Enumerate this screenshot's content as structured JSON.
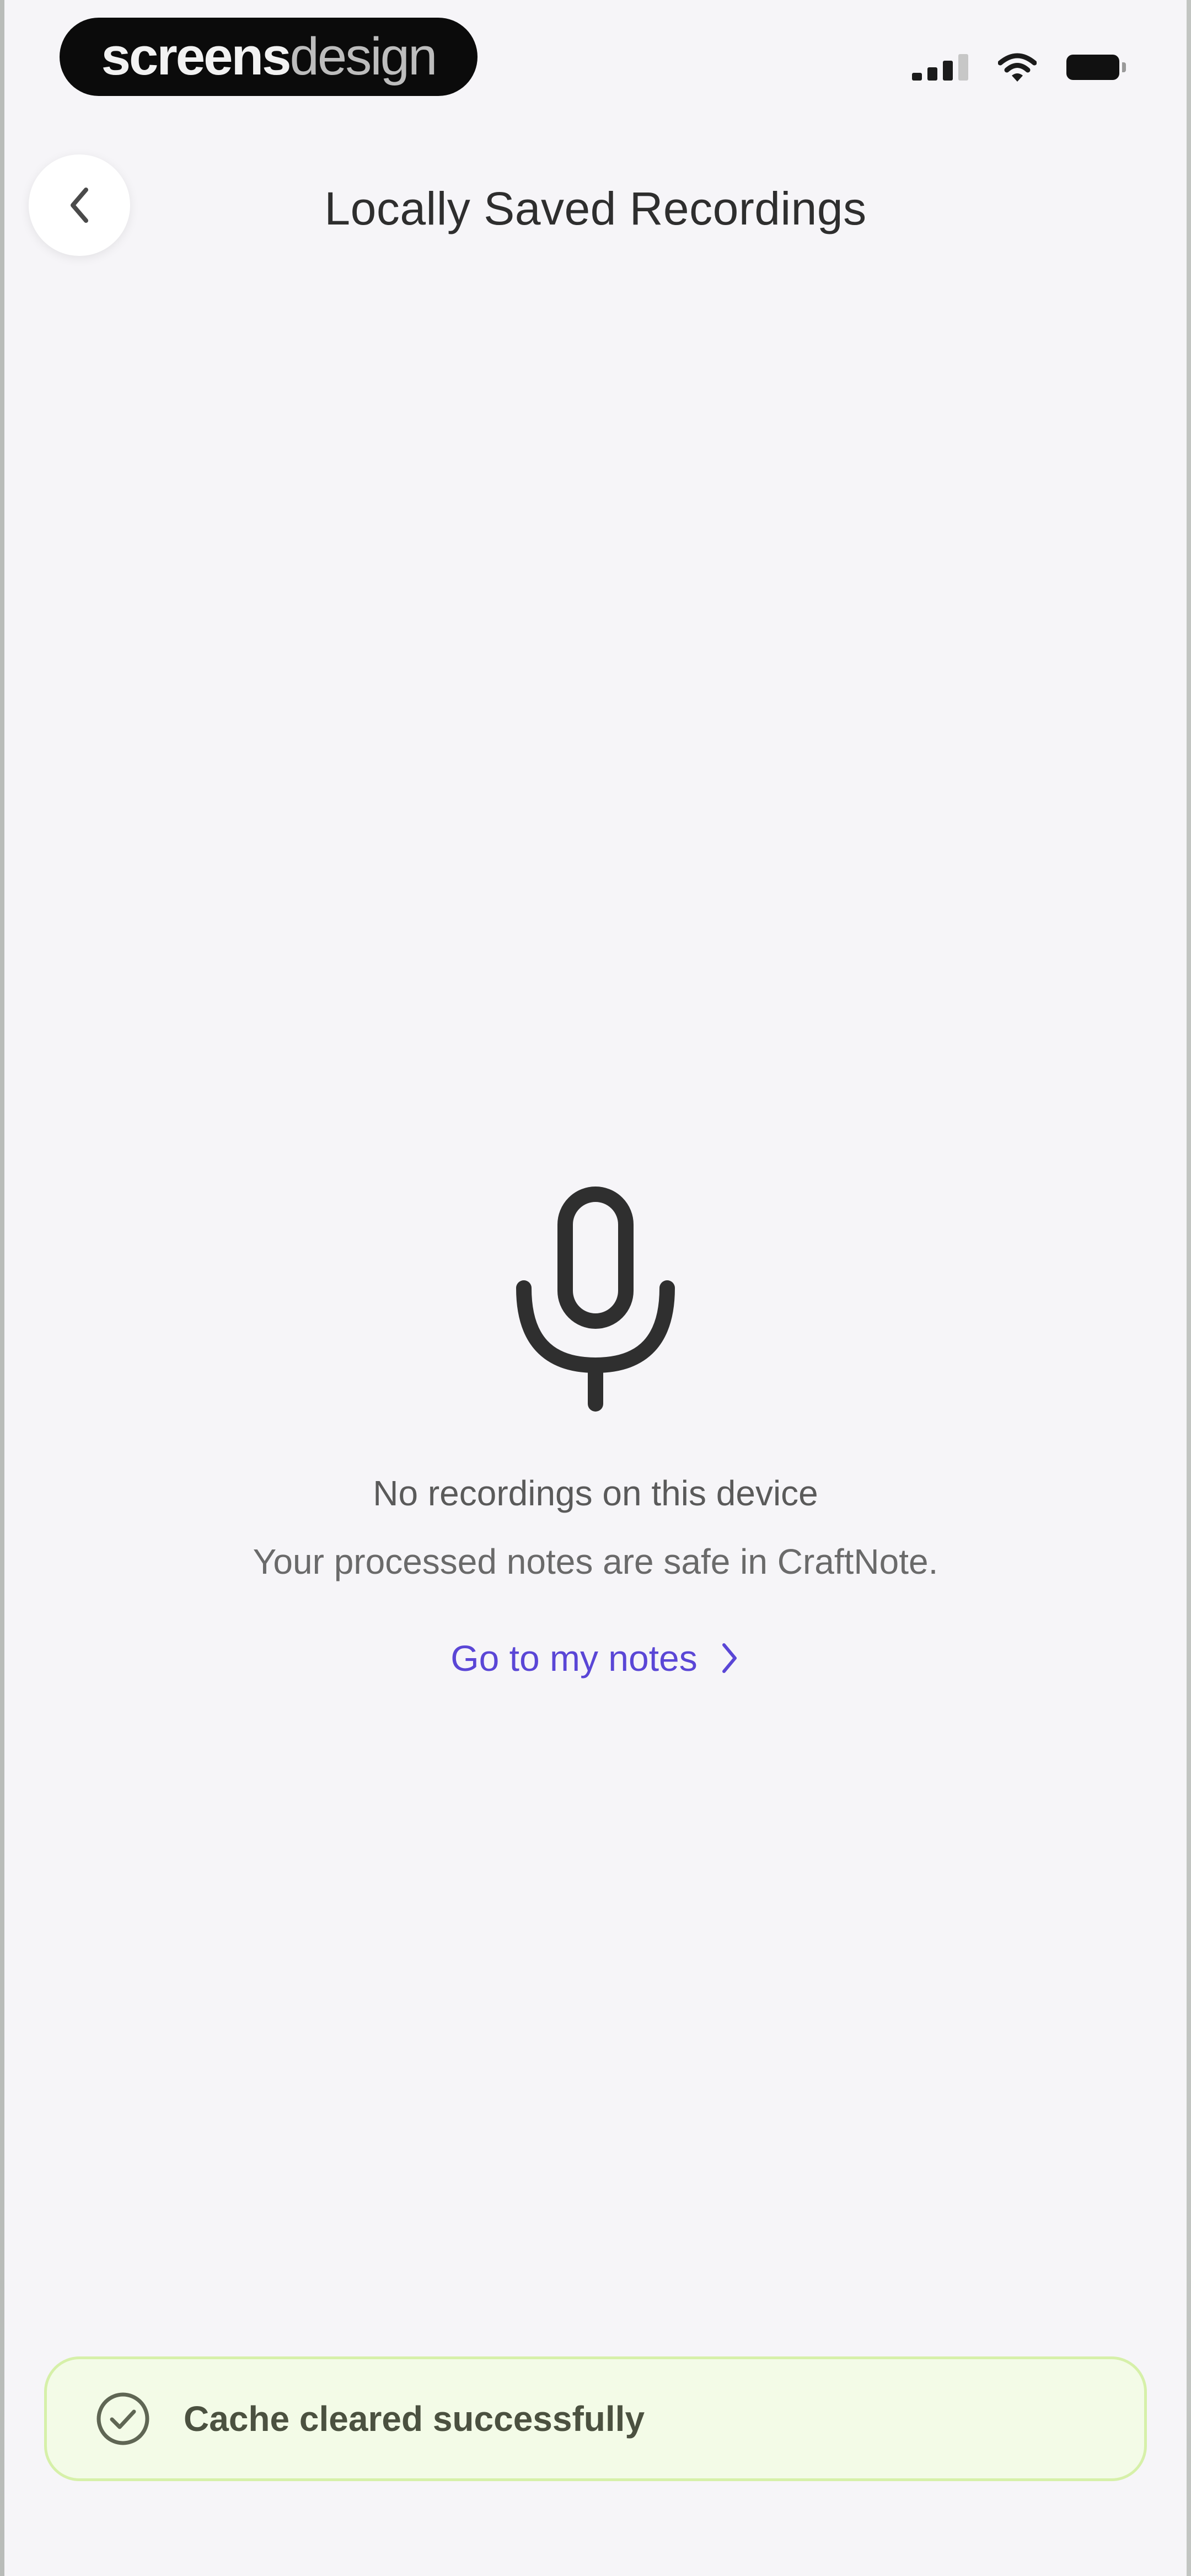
{
  "status_bar": {
    "brand_strong": "screens",
    "brand_light": "design",
    "icons": [
      "cellular-signal-icon",
      "wifi-icon",
      "battery-icon"
    ]
  },
  "header": {
    "back_icon": "chevron-left-icon",
    "title": "Locally Saved Recordings"
  },
  "empty_state": {
    "icon": "microphone-icon",
    "title": "No recordings on this device",
    "subtitle": "Your processed notes are safe in CraftNote.",
    "link_label": "Go to my notes",
    "link_icon": "chevron-right-icon"
  },
  "toast": {
    "icon": "check-circle-icon",
    "message": "Cache cleared successfully"
  },
  "colors": {
    "background": "#f6f5f8",
    "accent": "#5a46d6",
    "toast_background": "#f3fbe7",
    "toast_border": "#d6f0a9"
  }
}
